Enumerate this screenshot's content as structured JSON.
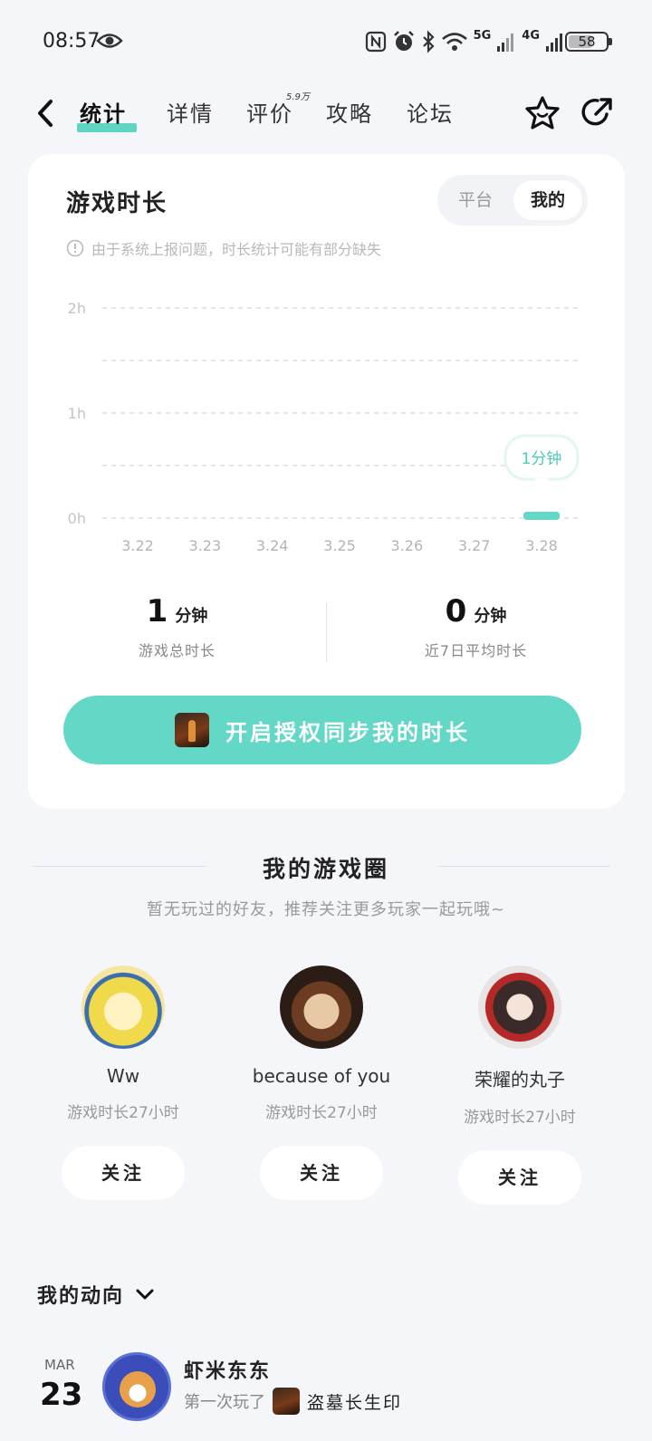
{
  "status_bar": {
    "time": "08:57",
    "battery": "58",
    "network_labels": [
      "5G",
      "4G"
    ]
  },
  "nav": {
    "tabs": [
      {
        "label": "统计",
        "active": true
      },
      {
        "label": "详情",
        "active": false
      },
      {
        "label": "评价",
        "active": false,
        "badge": "5.9万"
      },
      {
        "label": "攻略",
        "active": false
      },
      {
        "label": "论坛",
        "active": false
      }
    ]
  },
  "playtime_card": {
    "title": "游戏时长",
    "segments": [
      "平台",
      "我的"
    ],
    "selected_segment": "我的",
    "notice": "由于系统上报问题，时长统计可能有部分缺失",
    "stats": {
      "total_value": "1",
      "total_unit": "分钟",
      "total_label": "游戏总时长",
      "avg_value": "0",
      "avg_unit": "分钟",
      "avg_label": "近7日平均时长"
    },
    "sync_button": "开启授权同步我的时长"
  },
  "chart_data": {
    "type": "bar",
    "categories": [
      "3.22",
      "3.23",
      "3.24",
      "3.25",
      "3.26",
      "3.27",
      "3.28"
    ],
    "values": [
      0,
      0,
      0,
      0,
      0,
      0,
      1
    ],
    "value_unit": "minutes",
    "y_ticks": [
      "0h",
      "1h",
      "2h"
    ],
    "ylim_hours": [
      0,
      2
    ],
    "grid": true,
    "tooltip": "1分钟",
    "bar_color": "#63d8c7"
  },
  "game_circle": {
    "title": "我的游戏圈",
    "subtitle": "暂无玩过的好友，推荐关注更多玩家一起玩哦~",
    "friends": [
      {
        "name": "Ww",
        "playtime": "游戏时长27小时",
        "follow": "关注"
      },
      {
        "name": "because of you",
        "playtime": "游戏时长27小时",
        "follow": "关注"
      },
      {
        "name": "荣耀的丸子",
        "playtime": "游戏时长27小时",
        "follow": "关注"
      }
    ]
  },
  "activity": {
    "header": "我的动向",
    "month": "MAR",
    "day": "23",
    "user": "虾米东东",
    "desc_prefix": "第一次玩了",
    "game": "盗墓长生印"
  },
  "colors": {
    "accent": "#63d8c7",
    "background": "#f4f6f9"
  }
}
